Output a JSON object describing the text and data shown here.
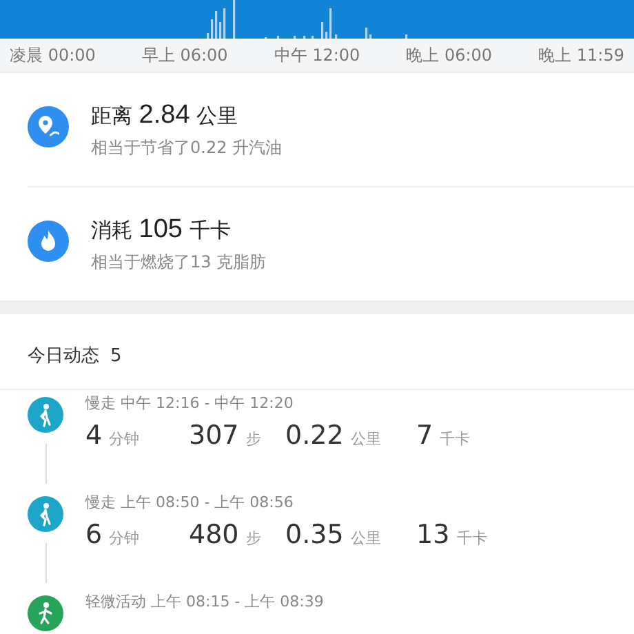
{
  "timeline": {
    "labels": [
      "凌晨 00:00",
      "早上 06:00",
      "中午 12:00",
      "晚上 06:00",
      "晚上 11:59"
    ]
  },
  "summary": [
    {
      "kind": "distance",
      "prefix": "距离",
      "value": "2.84",
      "unit": "公里",
      "note": "相当于节省了0.22 升汽油"
    },
    {
      "kind": "calories",
      "prefix": "消耗",
      "value": "105",
      "unit": "千卡",
      "note": "相当于燃烧了13 克脂肪"
    }
  ],
  "today": {
    "title": "今日动态",
    "count": "5"
  },
  "activities": [
    {
      "kind": "walk",
      "color": "#1ea6c9",
      "title": "慢走 中午 12:16 - 中午 12:20",
      "stats": [
        {
          "value": "4",
          "unit": "分钟"
        },
        {
          "value": "307",
          "unit": "步"
        },
        {
          "value": "0.22",
          "unit": "公里"
        },
        {
          "value": "7",
          "unit": "千卡"
        }
      ]
    },
    {
      "kind": "walk",
      "color": "#1ea6c9",
      "title": "慢走 上午 08:50 - 上午 08:56",
      "stats": [
        {
          "value": "6",
          "unit": "分钟"
        },
        {
          "value": "480",
          "unit": "步"
        },
        {
          "value": "0.35",
          "unit": "公里"
        },
        {
          "value": "13",
          "unit": "千卡"
        }
      ]
    },
    {
      "kind": "light",
      "color": "#27a35a",
      "title": "轻微活动 上午 08:15 - 上午 08:39"
    }
  ]
}
